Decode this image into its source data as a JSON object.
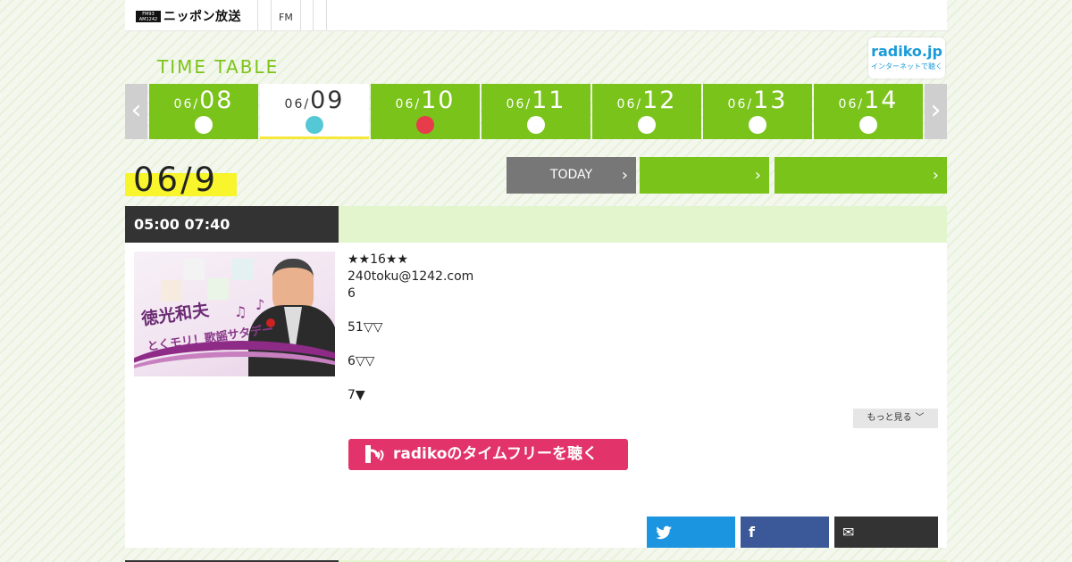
{
  "header": {
    "logo_badge_top": "FM93",
    "logo_badge_bottom": "AM1242",
    "logo_text": "ニッポン放送",
    "nav_fm": "FM"
  },
  "page": {
    "title": "TIME TABLE",
    "radiko_logo_top": "radiko.jp",
    "radiko_logo_bottom": "インターネットで聴く"
  },
  "date_nav": {
    "prev_glyph": "‹",
    "next_glyph": "›",
    "days": [
      {
        "month": "06/",
        "day": "08",
        "dot_color": "#ffffff",
        "active": false
      },
      {
        "month": "06/",
        "day": "09",
        "dot_color": "#55c8d6",
        "active": true
      },
      {
        "month": "06/",
        "day": "10",
        "dot_color": "#e63c4c",
        "active": false
      },
      {
        "month": "06/",
        "day": "11",
        "dot_color": "#ffffff",
        "active": false
      },
      {
        "month": "06/",
        "day": "12",
        "dot_color": "#ffffff",
        "active": false
      },
      {
        "month": "06/",
        "day": "13",
        "dot_color": "#ffffff",
        "active": false
      },
      {
        "month": "06/",
        "day": "14",
        "dot_color": "#ffffff",
        "active": false
      }
    ]
  },
  "current_date": "06/9",
  "actions": {
    "today_label": "TODAY",
    "btn2_label": "",
    "btn3_label": "",
    "chevron": "›"
  },
  "program": {
    "time_range": "05:00  07:40",
    "thumb_title": "徳光和夫",
    "thumb_subtitle": "とくモリ！歌謡サタデー",
    "description": [
      "★★16★★",
      "240toku@1242.com",
      "6",
      "",
      "51▽▽",
      "",
      "6▽▽",
      "",
      "7▼"
    ],
    "more_label": "もっと見る",
    "more_glyph": "﹀",
    "timefree_label": "radikoのタイムフリーを聴く",
    "share": {
      "twitter_icon": "twitter-bird",
      "facebook_glyph": "f",
      "mail_glyph": "✉"
    }
  },
  "colors": {
    "accent_green": "#7ac31a",
    "highlight_yellow": "#f8f52d",
    "radiko_pink": "#e2336b",
    "twitter_blue": "#1b95e0",
    "facebook_blue": "#3b5998"
  }
}
